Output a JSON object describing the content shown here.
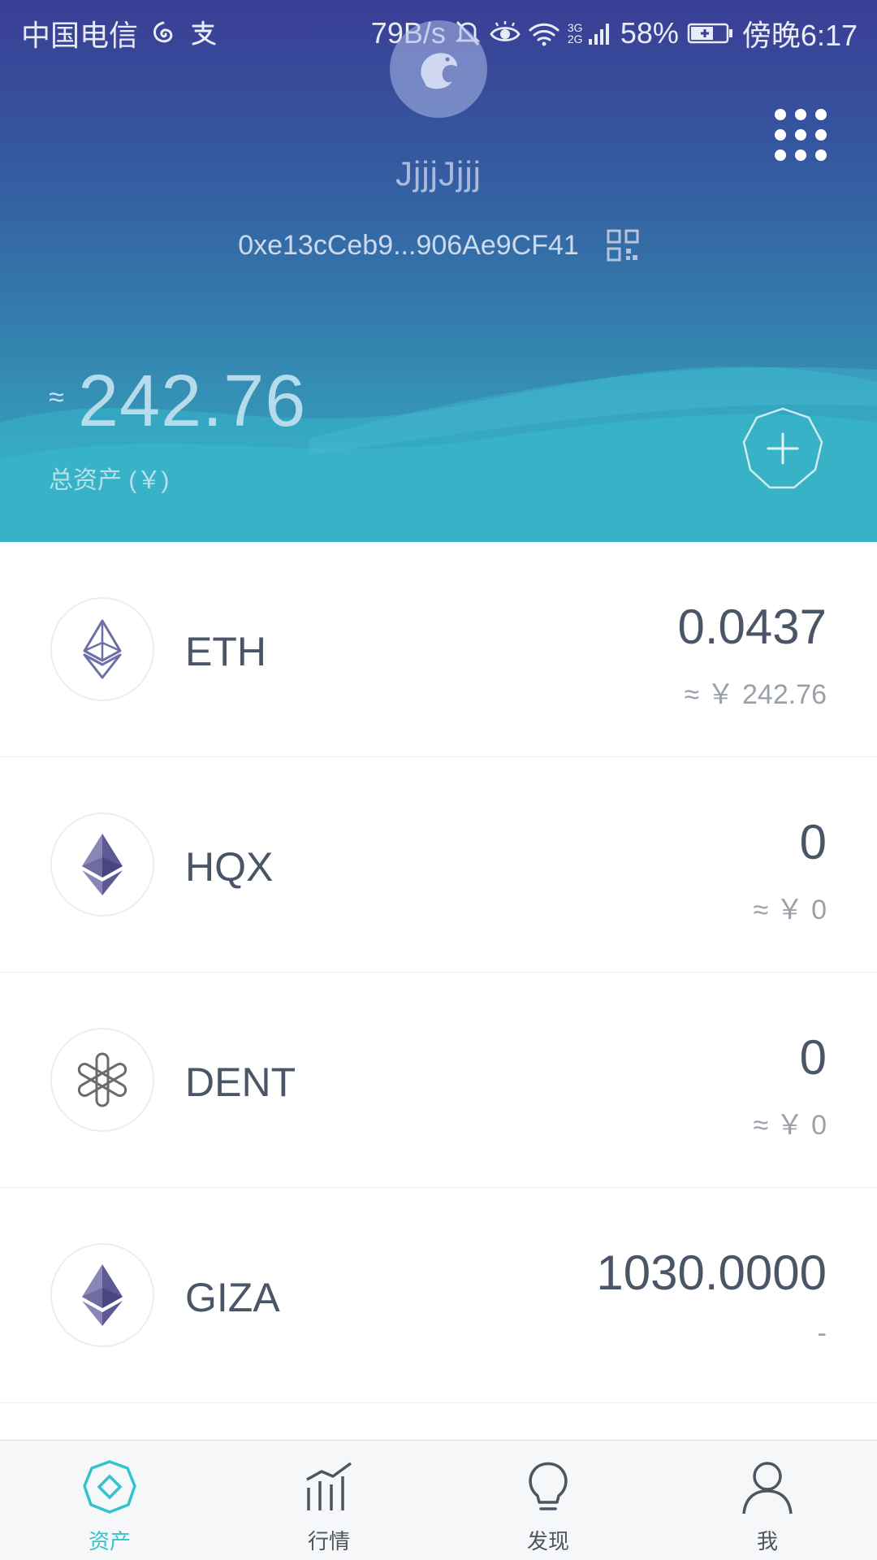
{
  "status_bar": {
    "carrier": "中国电信",
    "net_speed": "79B/s",
    "signal_labels": "3G 2G",
    "battery": "58%",
    "time": "傍晚6:17"
  },
  "wallet": {
    "name": "JjjjJjjj",
    "address": "0xe13cCeb9...906Ae9CF41"
  },
  "total": {
    "approx": "≈",
    "value": "242.76",
    "label": "总资产 (￥)"
  },
  "assets": [
    {
      "symbol": "ETH",
      "amount": "0.0437",
      "cny": "≈ ￥ 242.76",
      "icon": "eth-outline-icon"
    },
    {
      "symbol": "HQX",
      "amount": "0",
      "cny": "≈ ￥ 0",
      "icon": "eth-diamond-icon"
    },
    {
      "symbol": "DENT",
      "amount": "0",
      "cny": "≈ ￥ 0",
      "icon": "dent-icon"
    },
    {
      "symbol": "GIZA",
      "amount": "1030.0000",
      "cny": "-",
      "icon": "eth-diamond-icon"
    }
  ],
  "nav": [
    {
      "label": "资产",
      "icon": "assets-icon",
      "active": true
    },
    {
      "label": "行情",
      "icon": "market-chart-icon",
      "active": false
    },
    {
      "label": "发现",
      "icon": "lightbulb-icon",
      "active": false
    },
    {
      "label": "我",
      "icon": "profile-icon",
      "active": false
    }
  ],
  "colors": {
    "accent": "#35c2cf",
    "header_top": "#3a3e95",
    "header_bottom": "#36b2c7",
    "text_dark": "#4a5568",
    "text_muted": "#9aa1ab"
  }
}
